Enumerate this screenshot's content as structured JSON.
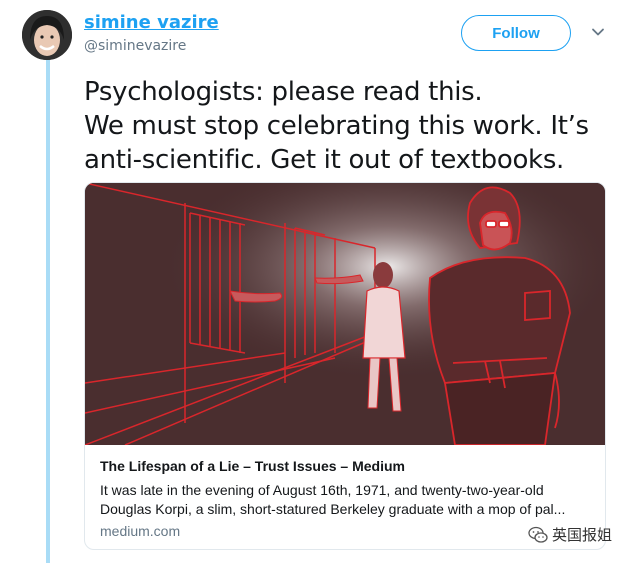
{
  "user": {
    "display_name": "simine vazire",
    "handle": "@siminevazire"
  },
  "follow_button": {
    "label": "Follow"
  },
  "tweet": {
    "lines": [
      "Psychologists: please read this.",
      "We must stop celebrating this work. It’s",
      "anti-scientific. Get it out of textbooks."
    ]
  },
  "card": {
    "title": "The Lifespan of a Lie – Trust Issues – Medium",
    "description_lines": [
      "It was late in the evening of August 16th, 1971, and twenty-two-year-old",
      "Douglas Korpi, a slim, short-statured Berkeley graduate with a mop of pal..."
    ],
    "domain": "medium.com"
  },
  "watermark": {
    "text": "英国报姐"
  },
  "colors": {
    "accent": "#1da1f2",
    "thread_line": "#a9dcf6",
    "illustration_red": "#d9262b"
  },
  "icons": {
    "caret": "chevron-down-icon",
    "watermark": "wechat-icon"
  }
}
